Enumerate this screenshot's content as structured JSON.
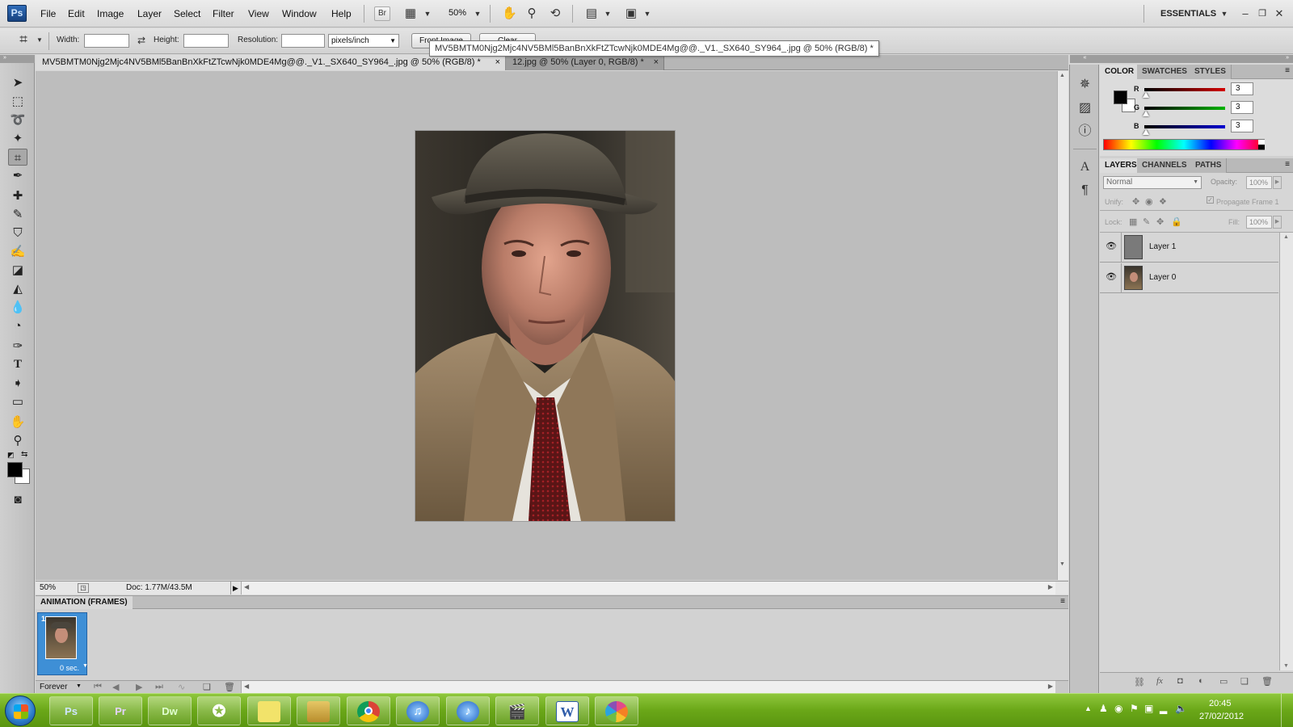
{
  "app": {
    "logo": "Ps",
    "menu": [
      "File",
      "Edit",
      "Image",
      "Layer",
      "Select",
      "Filter",
      "View",
      "Window",
      "Help"
    ],
    "bridge_label": "Br",
    "zoom": "50%",
    "workspace": "ESSENTIALS"
  },
  "options": {
    "width_label": "Width:",
    "width_value": "",
    "height_label": "Height:",
    "height_value": "",
    "resolution_label": "Resolution:",
    "resolution_value": "",
    "resolution_unit": "pixels/inch",
    "front_image_label": "Front Image",
    "clear_label": "Clear"
  },
  "tooltip": "MV5BMTM0Njg2Mjc4NV5BMl5BanBnXkFtZTcwNjk0MDE4Mg@@._V1._SX640_SY964_.jpg @ 50% (RGB/8) *",
  "tabs": [
    {
      "label": "MV5BMTM0Njg2Mjc4NV5BMl5BanBnXkFtZTcwNjk0MDE4Mg@@._V1._SX640_SY964_.jpg @ 50% (RGB/8) *",
      "close": "×"
    },
    {
      "label": "12.jpg @ 50% (Layer 0, RGB/8) *",
      "close": "×"
    }
  ],
  "status": {
    "zoom": "50%",
    "doc": "Doc: 1.77M/43.5M"
  },
  "animation": {
    "title": "ANIMATION (FRAMES)",
    "frame_number": "1",
    "frame_delay": "0 sec.",
    "loop": "Forever"
  },
  "color_panel": {
    "tabs": [
      "COLOR",
      "SWATCHES",
      "STYLES"
    ],
    "channels": [
      {
        "label": "R",
        "value": "3",
        "color": "#d40000"
      },
      {
        "label": "G",
        "value": "3",
        "color": "#00b400"
      },
      {
        "label": "B",
        "value": "3",
        "color": "#0000d0"
      }
    ],
    "foreground": "#030303",
    "background": "#ffffff"
  },
  "layers_panel": {
    "tabs": [
      "LAYERS",
      "CHANNELS",
      "PATHS"
    ],
    "blend_mode": "Normal",
    "opacity_label": "Opacity:",
    "opacity_value": "100%",
    "unify_label": "Unify:",
    "propagate_label": "Propagate Frame 1",
    "lock_label": "Lock:",
    "fill_label": "Fill:",
    "fill_value": "100%",
    "layers": [
      {
        "name": "Layer 1",
        "visible": true
      },
      {
        "name": "Layer 0",
        "visible": true
      }
    ]
  },
  "taskbar": {
    "apps": [
      {
        "label": "Ps",
        "icon": "photoshop-icon",
        "color": "#2e6eb5"
      },
      {
        "label": "Pr",
        "icon": "premiere-icon",
        "color": "#6c4aa0"
      },
      {
        "label": "Dw",
        "icon": "dreamweaver-icon",
        "color": "#3f7f1a"
      },
      {
        "label": "",
        "icon": "game-controller-icon",
        "color": "#333333"
      },
      {
        "label": "",
        "icon": "sticky-notes-icon",
        "color": "#f2e36a"
      },
      {
        "label": "",
        "icon": "file-explorer-icon",
        "color": "#e6c766"
      },
      {
        "label": "",
        "icon": "chrome-icon",
        "color": "#d33a2c"
      },
      {
        "label": "",
        "icon": "itunes-icon",
        "color": "#2b6fd0"
      },
      {
        "label": "",
        "icon": "itunes-alt-icon",
        "color": "#2b6fd0"
      },
      {
        "label": "",
        "icon": "clapperboard-icon",
        "color": "#555555"
      },
      {
        "label": "W",
        "icon": "word-icon",
        "color": "#2c5aa8"
      },
      {
        "label": "",
        "icon": "picasa-icon",
        "color": "#e24a8a"
      }
    ],
    "time": "20:45",
    "date": "27/02/2012"
  }
}
